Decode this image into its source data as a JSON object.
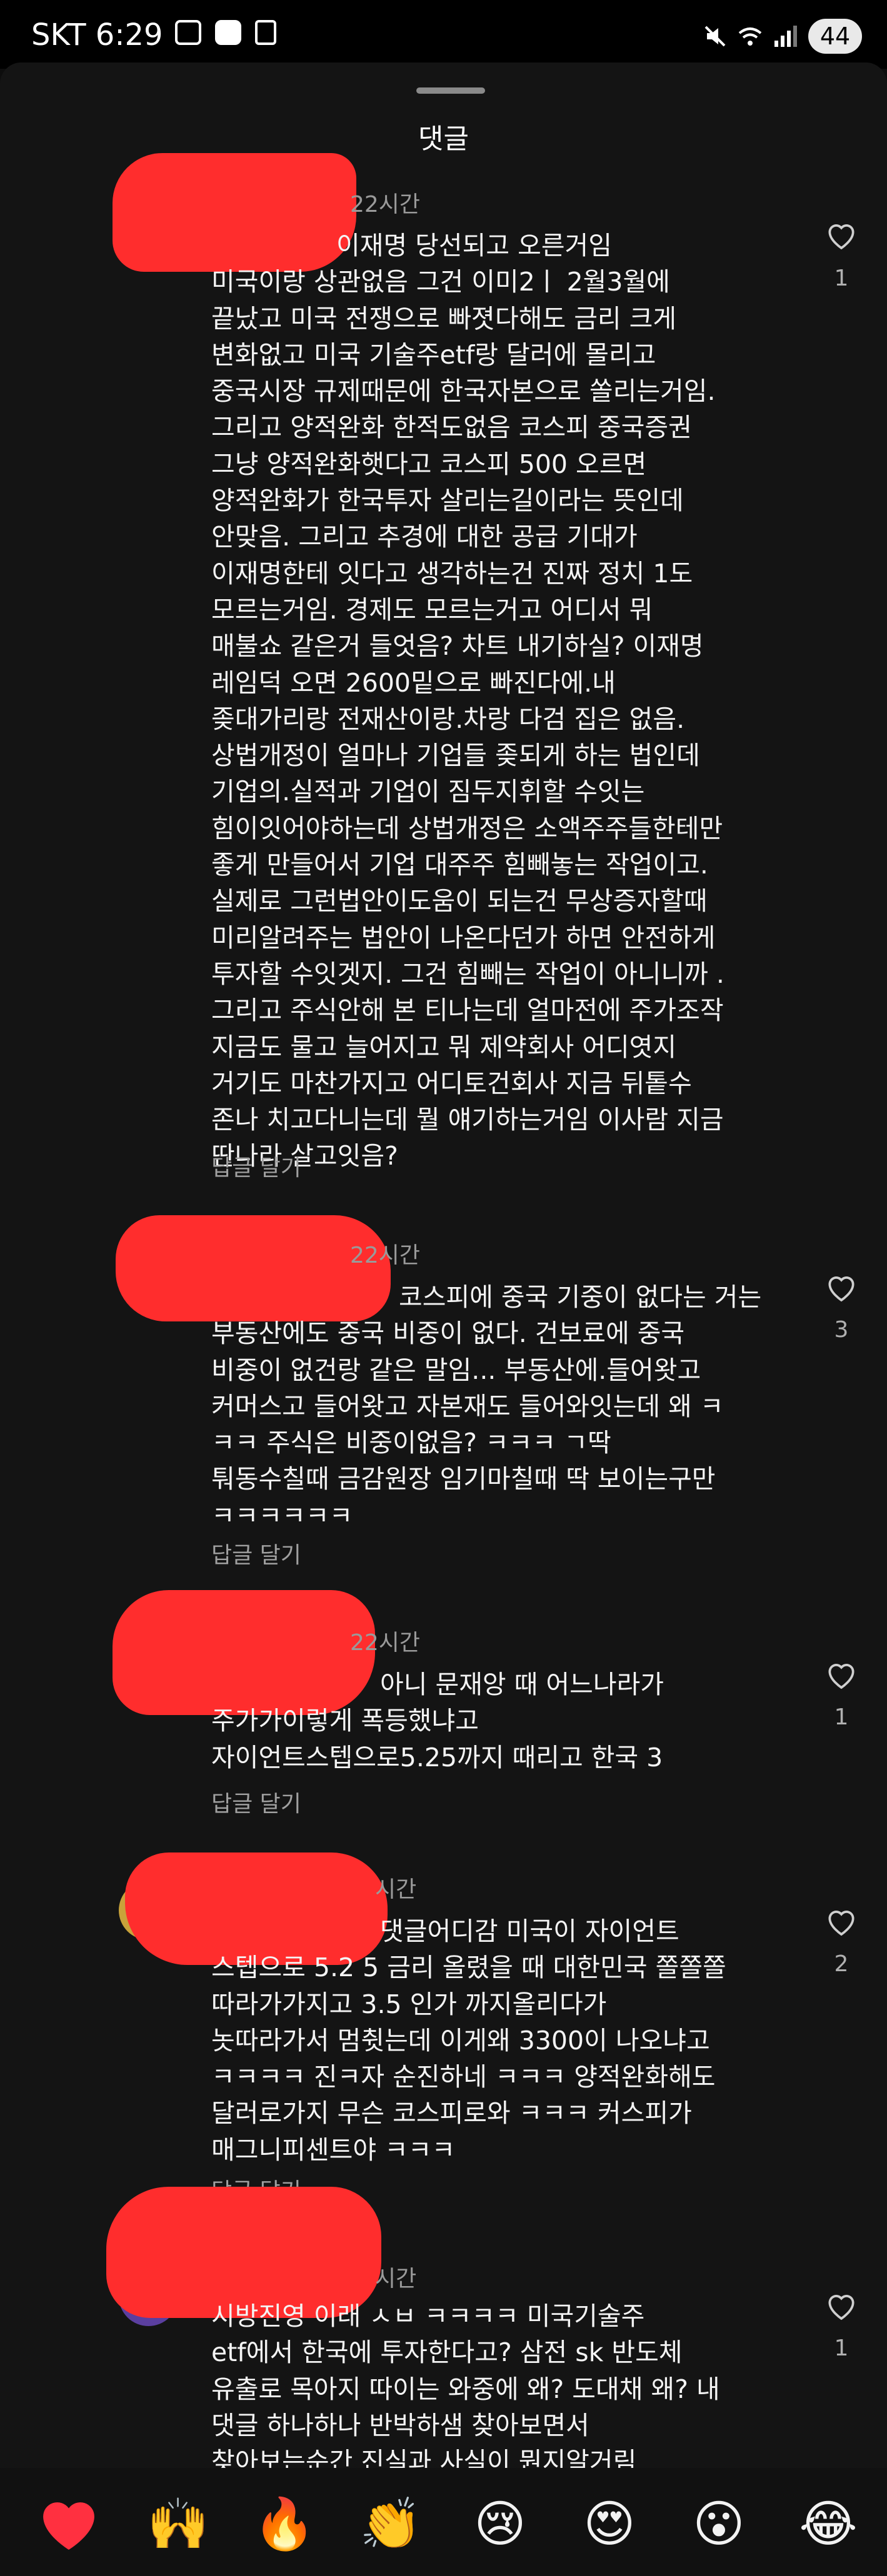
{
  "status_bar": {
    "carrier_time": "SKT 6:29",
    "battery": "44"
  },
  "sheet": {
    "title": "댓글"
  },
  "comments": [
    {
      "time": "22시간",
      "text": "이재명 당선되고 오른거임\n미국이랑 상관없음 그건 이미2ㅣ 2월3월에\n끝났고 미국 전쟁으로 빠졋다해도 금리 크게\n변화없고 미국 기술주etf랑 달러에 몰리고\n중국시장 규제때문에 한국자본으로 쏠리는거임.\n그리고 양적완화 한적도없음 코스피 중국증권\n그냥 양적완화햇다고 코스피 500 오르면\n양적완화가 한국투자 살리는길이라는 뜻인데\n안맞음. 그리고 추경에 대한 공급 기대가\n이재명한테 잇다고 생각하는건 진짜 정치 1도\n모르는거임. 경제도 모르는거고 어디서 뭐\n매불쇼 같은거 들엇음? 차트 내기하실? 이재명\n레임덕 오면 2600밑으로 빠진다에.내\n좆대가리랑 전재산이랑.차랑 다검 집은 없음.\n상법개정이 얼마나 기업들 좆되게 하는 법인데\n기업의.실적과 기업이 짐두지휘할 수잇는\n힘이잇어야하는데 상법개정은 소액주주들한테만\n좋게 만들어서 기업 대주주 힘빼놓는 작업이고.\n실제로 그런법안이도움이 되는건 무상증자할때\n미리알려주는 법안이 나온다던가 하면 안전하게\n투자할 수잇겟지. 그건 힘빼는 작업이 아니니까 .\n그리고 주식안해 본 티나는데 얼마전에 주가조작\n지금도 물고 늘어지고 뭐 제약회사 어디엿지\n거기도 마찬가지고 어디토건회사 지금 뒤톹수\n존나 치고다니는데 뭘 얘기하는거임 이사람 지금\n딴나라 살고잇음?",
      "reply": "답글 달기",
      "likes": "1"
    },
    {
      "time": "22시간",
      "text": "코스피에 중국 기중이 없다는 거는\n부동산에도 중국 비중이 없다. 건보료에 중국\n비중이 없건랑 같은 말임... 부동산에.들어왓고\n커머스고 들어왓고 자본재도 들어와잇는데 왜 ㅋ\nㅋㅋ 주식은 비중이없음? ㅋㅋㅋ ㄱ딱\n퉈동수칠때 금감원장 임기마칠때 딱 보이는구만\nㅋㅋㅋㅋㅋㅋ",
      "reply": "답글 달기",
      "likes": "3"
    },
    {
      "time": "22시간",
      "text": "아니 문재앙 때 어느나라가\n주가가이렇게 폭등했냐고\n자이언트스텝으로5.25까지 때리고 한국 3",
      "reply": "답글 달기",
      "likes": "1"
    },
    {
      "time": "시간",
      "text": "댓글어디감 미국이 자이언트\n스텝으로 5.2 5 금리 올렸을 때 대한민국 쫄쫄쫄\n따라가가지고 3.5 인가 까지올리다가\n놋따라가서 멈췻는데 이게왜 3300이 나오냐고\nㅋㅋㅋㅋ 진ㅋ자 순진하네 ㅋㅋㅋ 양적완화해도\n달러로가지 무슨 코스피로와 ㅋㅋㅋ 커스피가\n매그니피센트야 ㅋㅋㅋ",
      "reply": "답글 달기",
      "likes": "2"
    },
    {
      "time": "시간",
      "text": "시방진영 이래 ㅅㅂ ㅋㅋㅋㅋ 미국기술주\netf에서 한국에 투자한다고? 삼전 sk 반도체\n유출로 목아지 따이는 와중에 왜? 도대채 왜? 내\n댓글 하나하나 반박하샘 찾아보면서\n찾아보는순간 진실과 사실이 뭔지알거림",
      "reply": "",
      "likes": "1"
    }
  ],
  "emoji_bar": {
    "emojis": [
      "❤",
      "🙌",
      "🔥",
      "👏",
      "😢",
      "😍",
      "😮",
      "😂"
    ]
  },
  "colors": {
    "background": "#141414",
    "redaction": "#ff2d2d",
    "heart": "#ff3040"
  }
}
